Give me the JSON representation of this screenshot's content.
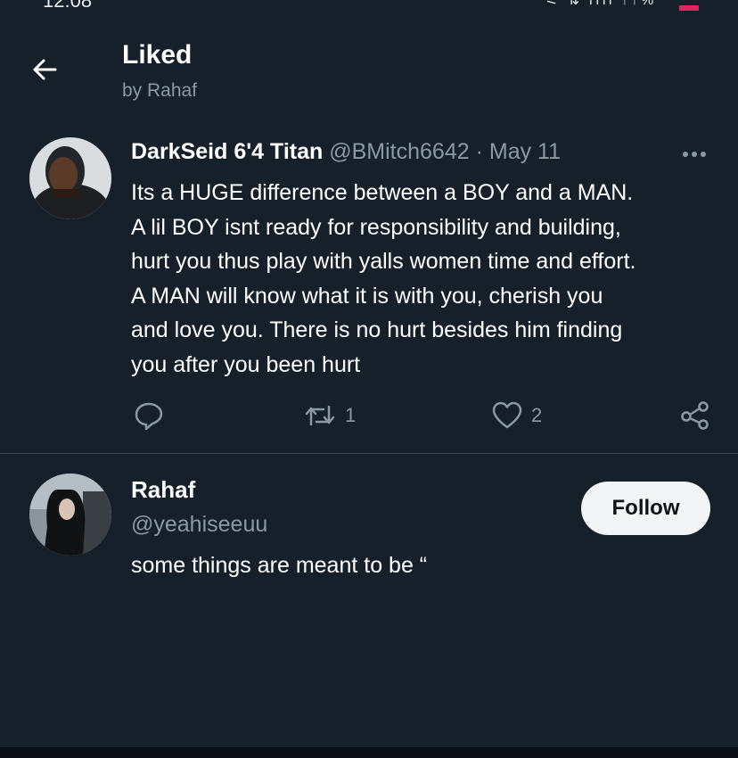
{
  "statusbar": {
    "time": "12:08",
    "icons": "⚟ ⇅ ıııl ↑↑%"
  },
  "header": {
    "title": "Liked",
    "subtitle": "by Rahaf"
  },
  "tweet": {
    "author_name": "DarkSeid 6'4 Titan",
    "author_meta": "@BMitch6642 · May 11",
    "lines": [
      "Its a HUGE difference between a BOY and a MAN.",
      "A lil BOY isnt ready for responsibility and building,",
      "hurt you thus play with yalls women time and effort.",
      "A MAN will know what it is with you, cherish you",
      "and love you. There is no hurt besides him finding",
      "you after you been hurt"
    ],
    "retweet_count": "1",
    "like_count": "2"
  },
  "user": {
    "name": "Rahaf",
    "handle": "@yeahiseeuu",
    "bio": "some things are meant to be “",
    "follow_label": "Follow"
  },
  "icons": {
    "back": "back-arrow-icon",
    "more": "more-icon",
    "reply": "reply-icon",
    "retweet": "retweet-icon",
    "like": "heart-icon",
    "share": "share-icon"
  },
  "colors": {
    "background": "#15202b",
    "secondary_text": "#8b98a5",
    "divider": "#38444d",
    "follow_bg": "#f2f4f5"
  }
}
